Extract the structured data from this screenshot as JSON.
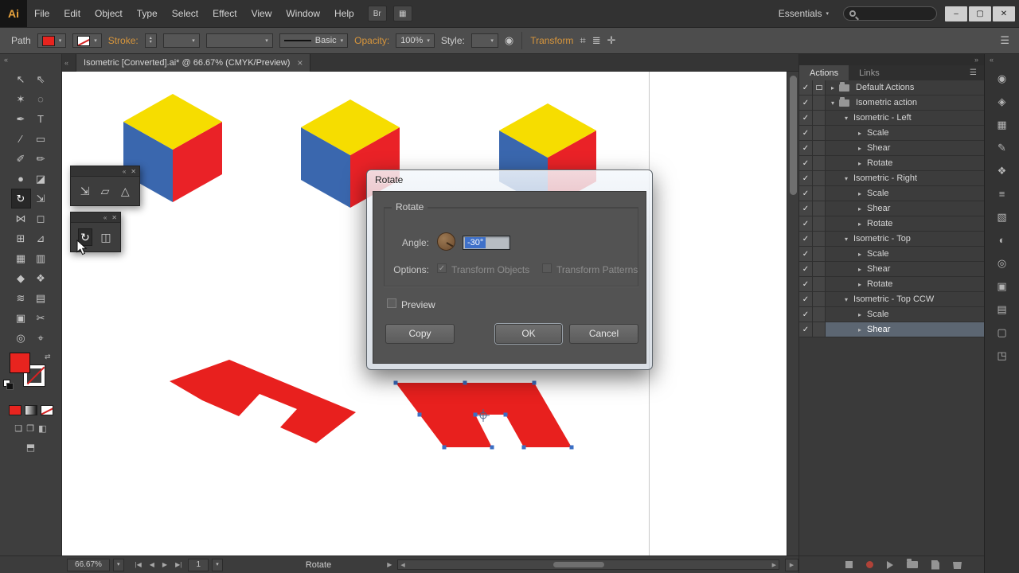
{
  "icons": {
    "check": "✓",
    "caret_down": "▾",
    "arrow_open": "▾",
    "arrow_closed": "▸",
    "collapse_left": "«",
    "collapse_right": "»",
    "close_x": "✕",
    "panel_menu": "☰",
    "tab_close": "×",
    "up_tick": "▴",
    "down_tick": "▾"
  },
  "window": {
    "logo": "Ai",
    "minimize": "–",
    "maximize": "▢",
    "close": "✕"
  },
  "menubar": {
    "items": [
      "File",
      "Edit",
      "Object",
      "Type",
      "Select",
      "Effect",
      "View",
      "Window",
      "Help"
    ],
    "bridge_label": "Br",
    "arrange_glyph": "▦",
    "workspace": "Essentials"
  },
  "control_bar": {
    "selection_type": "Path",
    "stroke_label": "Stroke:",
    "brush_name": "Basic",
    "opacity_label": "Opacity:",
    "opacity_value": "100%",
    "style_label": "Style:",
    "transform_link": "Transform",
    "doc_setup_glyph": "◉",
    "align_glyph": "⌗",
    "grid_glyph": "≣",
    "free_transform_glyph": "✛",
    "panel_menu_glyph": "☰"
  },
  "document": {
    "tab_title": "Isometric [Converted].ai* @ 66.67% (CMYK/Preview)"
  },
  "toolbar": {
    "tools": [
      {
        "name": "selection-tool",
        "glyph": "↖"
      },
      {
        "name": "direct-selection-tool",
        "glyph": "⇖"
      },
      {
        "name": "magic-wand-tool",
        "glyph": "✶"
      },
      {
        "name": "lasso-tool",
        "glyph": "◌"
      },
      {
        "name": "pen-tool",
        "glyph": "✒"
      },
      {
        "name": "type-tool",
        "glyph": "T"
      },
      {
        "name": "line-segment-tool",
        "glyph": "∕"
      },
      {
        "name": "rectangle-tool",
        "glyph": "▭"
      },
      {
        "name": "paintbrush-tool",
        "glyph": "✐"
      },
      {
        "name": "pencil-tool",
        "glyph": "✏"
      },
      {
        "name": "blob-brush-tool",
        "glyph": "●"
      },
      {
        "name": "eraser-tool",
        "glyph": "◪"
      },
      {
        "name": "rotate-tool",
        "glyph": "↻",
        "pressed": true
      },
      {
        "name": "scale-tool",
        "glyph": "⇲"
      },
      {
        "name": "width-tool",
        "glyph": "⋈"
      },
      {
        "name": "free-transform-tool",
        "glyph": "◻"
      },
      {
        "name": "shape-builder-tool",
        "glyph": "⊞"
      },
      {
        "name": "perspective-grid-tool",
        "glyph": "⊿"
      },
      {
        "name": "mesh-tool",
        "glyph": "▦"
      },
      {
        "name": "gradient-tool",
        "glyph": "▥"
      },
      {
        "name": "eyedropper-tool",
        "glyph": "◆"
      },
      {
        "name": "blend-tool",
        "glyph": "❖"
      },
      {
        "name": "symbol-sprayer-tool",
        "glyph": "≋"
      },
      {
        "name": "column-graph-tool",
        "glyph": "▤"
      },
      {
        "name": "artboard-tool",
        "glyph": "▣"
      },
      {
        "name": "slice-tool",
        "glyph": "✂"
      },
      {
        "name": "hand-tool",
        "glyph": "◎"
      },
      {
        "name": "zoom-tool",
        "glyph": "⌖"
      }
    ]
  },
  "floating_panels": [
    {
      "icons": [
        {
          "name": "scale-tool",
          "glyph": "⇲"
        },
        {
          "name": "shear-tool",
          "glyph": "▱"
        },
        {
          "name": "reshape-tool",
          "glyph": "△"
        }
      ]
    },
    {
      "icons": [
        {
          "name": "rotate-tool",
          "glyph": "↻",
          "pressed": true
        },
        {
          "name": "reflect-tool",
          "glyph": "◫"
        }
      ]
    }
  ],
  "dialog": {
    "title": "Rotate",
    "group_title": "Rotate",
    "angle_label": "Angle:",
    "angle_value": "-30°",
    "options_label": "Options:",
    "transform_objects_label": "Transform Objects",
    "transform_patterns_label": "Transform Patterns",
    "preview_label": "Preview",
    "copy_button": "Copy",
    "ok_button": "OK",
    "cancel_button": "Cancel"
  },
  "actions_panel": {
    "tabs": [
      {
        "label": "Actions",
        "active": true
      },
      {
        "label": "Links",
        "active": false
      }
    ],
    "rows": [
      {
        "label": "Default Actions",
        "indent": 0,
        "open": false,
        "folder": true,
        "checked": true,
        "modal": true
      },
      {
        "label": "Isometric action",
        "indent": 0,
        "open": true,
        "folder": true,
        "checked": true
      },
      {
        "label": "Isometric - Left",
        "indent": 1,
        "open": true,
        "checked": true
      },
      {
        "label": "Scale",
        "indent": 2,
        "open": false,
        "checked": true
      },
      {
        "label": "Shear",
        "indent": 2,
        "open": false,
        "checked": true
      },
      {
        "label": "Rotate",
        "indent": 2,
        "open": false,
        "checked": true
      },
      {
        "label": "Isometric - Right",
        "indent": 1,
        "open": true,
        "checked": true
      },
      {
        "label": "Scale",
        "indent": 2,
        "open": false,
        "checked": true
      },
      {
        "label": "Shear",
        "indent": 2,
        "open": false,
        "checked": true
      },
      {
        "label": "Rotate",
        "indent": 2,
        "open": false,
        "checked": true
      },
      {
        "label": "Isometric - Top",
        "indent": 1,
        "open": true,
        "checked": true
      },
      {
        "label": "Scale",
        "indent": 2,
        "open": false,
        "checked": true
      },
      {
        "label": "Shear",
        "indent": 2,
        "open": false,
        "checked": true
      },
      {
        "label": "Rotate",
        "indent": 2,
        "open": false,
        "checked": true
      },
      {
        "label": "Isometric - Top CCW",
        "indent": 1,
        "open": true,
        "checked": true
      },
      {
        "label": "Scale",
        "indent": 2,
        "open": false,
        "checked": true
      },
      {
        "label": "Shear",
        "indent": 2,
        "open": false,
        "checked": true,
        "selected": true
      }
    ],
    "footer": [
      {
        "name": "stop-button",
        "cls": "ic-stop"
      },
      {
        "name": "record-button",
        "cls": "ic-record"
      },
      {
        "name": "play-button",
        "cls": "ic-play"
      },
      {
        "name": "new-set-button",
        "cls": "ic-folder"
      },
      {
        "name": "new-action-button",
        "cls": "ic-page"
      },
      {
        "name": "delete-button",
        "cls": "ic-trash"
      }
    ]
  },
  "panel_strip": {
    "icons": [
      {
        "name": "color-panel-icon",
        "glyph": "◉"
      },
      {
        "name": "color-guide-panel-icon",
        "glyph": "◈"
      },
      {
        "name": "swatches-panel-icon",
        "glyph": "▦"
      },
      {
        "name": "brushes-panel-icon",
        "glyph": "✎"
      },
      {
        "name": "symbols-panel-icon",
        "glyph": "❖"
      },
      {
        "name": "stroke-panel-icon",
        "glyph": "≡"
      },
      {
        "name": "gradient-panel-icon",
        "glyph": "▧"
      },
      {
        "name": "transparency-panel-icon",
        "glyph": "◐"
      },
      {
        "name": "appearance-panel-icon",
        "glyph": "◎"
      },
      {
        "name": "graphic-styles-panel-icon",
        "glyph": "▣"
      },
      {
        "name": "layers-panel-icon",
        "glyph": "▤"
      },
      {
        "name": "artboards-panel-icon",
        "glyph": "▢"
      },
      {
        "name": "navigator-panel-icon",
        "glyph": "◳"
      }
    ]
  },
  "status_bar": {
    "zoom": "66.67%",
    "artboard": "1",
    "tool_status": "Rotate",
    "nav": [
      {
        "name": "first-artboard-button",
        "glyph": "|◀"
      },
      {
        "name": "prev-artboard-button",
        "glyph": "◀"
      },
      {
        "name": "next-artboard-button",
        "glyph": "▶"
      },
      {
        "name": "last-artboard-button",
        "glyph": "▶|"
      }
    ]
  },
  "canvas": {
    "colors": {
      "cube_top": "#f6dd00",
      "cube_left": "#3a67ae",
      "cube_right": "#ea2227",
      "shape_red": "#e8201e",
      "anchor": "#3b6fc4",
      "artboard_edge": "#c8c8c8"
    }
  }
}
